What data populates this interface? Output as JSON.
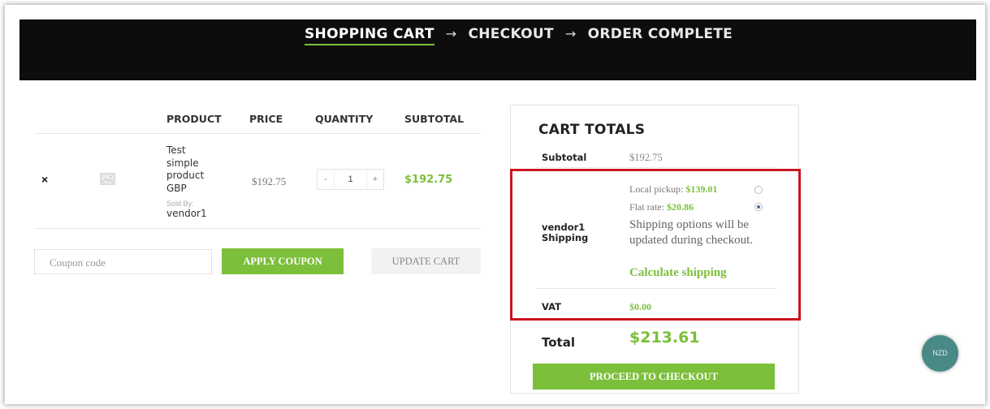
{
  "steps": {
    "active": "SHOPPING CART",
    "checkout": "CHECKOUT",
    "complete": "ORDER COMPLETE",
    "arrow": "→"
  },
  "cart_table": {
    "headers": {
      "product": "PRODUCT",
      "price": "PRICE",
      "quantity": "QUANTITY",
      "subtotal": "SUBTOTAL"
    },
    "item": {
      "remove": "×",
      "name_lines": [
        "Test",
        "simple",
        "product",
        "GBP"
      ],
      "sold_by_label": "Sold By:",
      "vendor": "vendor1",
      "price": "$192.75",
      "qty_minus": "-",
      "qty": "1",
      "qty_plus": "+",
      "subtotal": "$192.75"
    }
  },
  "coupon": {
    "placeholder": "Coupon code",
    "apply_label": "APPLY COUPON",
    "update_label": "UPDATE CART"
  },
  "totals": {
    "title": "CART TOTALS",
    "subtotal_label": "Subtotal",
    "subtotal_value": "$192.75",
    "shipping_label_1": "vendor1",
    "shipping_label_2": "Shipping",
    "local_pickup_label": "Local pickup:",
    "local_pickup_value": "$139.01",
    "flat_rate_label": "Flat rate:",
    "flat_rate_value": "$20.86",
    "shipping_note": "Shipping options will be updated during checkout.",
    "calculate_shipping": "Calculate shipping",
    "vat_label": "VAT",
    "vat_value": "$0.00",
    "total_label": "Total",
    "total_value": "$213.61",
    "checkout_label": "PROCEED TO CHECKOUT"
  },
  "currency_switcher": {
    "label": "NZD"
  },
  "colors": {
    "accent": "#7cbf3a",
    "header_bg": "#0d0d0d",
    "highlight": "#c9141f",
    "currency_bg": "#4a8a86"
  }
}
